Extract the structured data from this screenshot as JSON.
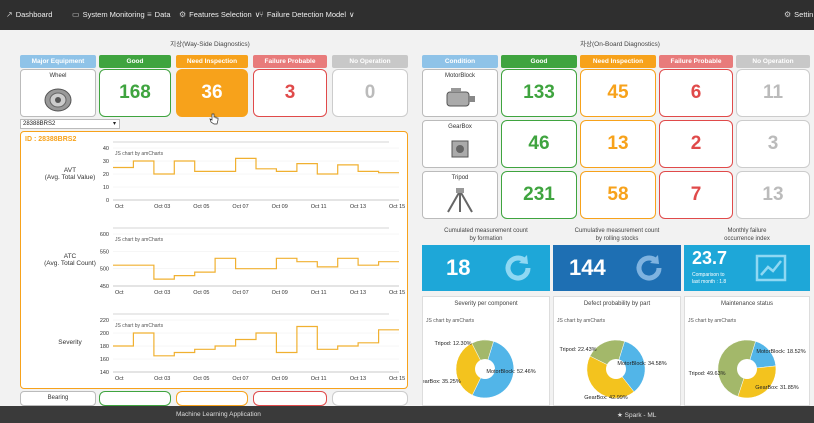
{
  "nav": {
    "items": [
      {
        "icon": "chart-line-icon",
        "glyph": "↗",
        "label": "Dashboard"
      },
      {
        "icon": "monitor-icon",
        "glyph": "▭",
        "label": "System Monitoring"
      },
      {
        "icon": "database-icon",
        "glyph": "≡",
        "label": "Data"
      },
      {
        "icon": "gear-icon",
        "glyph": "⚙",
        "label": "Features Selection"
      },
      {
        "icon": "sitemap-icon",
        "glyph": "⑂",
        "label": "Failure Detection Model"
      }
    ],
    "settings_label": "Settin",
    "settings_glyph": "⚙"
  },
  "wayside": {
    "title": "지상(Way-Side Diagnostics)",
    "headers": [
      "Major Equipment",
      "Good",
      "Need Inspection",
      "Failure Probable",
      "No Operation"
    ],
    "rows": [
      {
        "equipment": "Wheel",
        "good": "168",
        "need": "36",
        "fail": "3",
        "noop": "0"
      },
      {
        "equipment": "Bearing"
      }
    ],
    "select_value": "28388BRS2",
    "select_arrow": "▾",
    "id_label": "ID : 28388BRS2",
    "chart_rows": [
      {
        "label1": "AVT",
        "label2": "(Avg. Total Value)"
      },
      {
        "label1": "ATC",
        "label2": "(Avg. Total Count)"
      },
      {
        "label1": "Severity",
        "label2": ""
      }
    ],
    "credit": "JS chart by amCharts"
  },
  "onboard": {
    "title": "차상(On-Board Diagnostics)",
    "headers": [
      "Condition",
      "Good",
      "Need Inspection",
      "Failure Probable",
      "No Operation"
    ],
    "rows": [
      {
        "condition": "MotorBlock",
        "good": "133",
        "need": "45",
        "fail": "6",
        "noop": "11"
      },
      {
        "condition": "GearBox",
        "good": "46",
        "need": "13",
        "fail": "2",
        "noop": "3"
      },
      {
        "condition": "Tripod",
        "good": "231",
        "need": "58",
        "fail": "7",
        "noop": "13"
      }
    ],
    "kpis": [
      {
        "title1": "Cumulated measurement count",
        "title2": "by formation",
        "value": "18",
        "color": "#1ea7d8"
      },
      {
        "title1": "Cumulative measurement count",
        "title2": "by rolling stocks",
        "value": "144",
        "color": "#1e6fb3"
      },
      {
        "title1": "Monthly failure",
        "title2": "occurrence index",
        "value": "23.7",
        "sub1": "Comparison to",
        "sub2": "last month : 1.8",
        "color": "#1ea7d8"
      }
    ],
    "cards": [
      {
        "title": "Severity per component",
        "credit": "JS chart by amCharts"
      },
      {
        "title": "Defect probability by part",
        "credit": "JS chart by amCharts"
      },
      {
        "title": "Maintenance status",
        "credit": "JS chart by amCharts"
      }
    ]
  },
  "footer": {
    "left": "Machine Learning Application",
    "right": "Spark - ML",
    "right_glyph": "★"
  },
  "colors": {
    "good": "#3fa43f",
    "need": "#f7a21b",
    "fail": "#e04a4a",
    "noop": "#cccccc",
    "condition": "#8fc3e8",
    "line": "#f0b030"
  },
  "chart_data": [
    {
      "type": "line",
      "name": "AVT",
      "x": [
        "Oct",
        "Oct 03",
        "Oct 05",
        "Oct 07",
        "Oct 09",
        "Oct 11",
        "Oct 13",
        "Oct 15"
      ],
      "xticks": [
        "Oct",
        "Oct 03",
        "Oct 05",
        "Oct 07",
        "Oct 09",
        "Oct 11",
        "Oct 13",
        "Oct 15"
      ],
      "yticks": [
        "40",
        "30",
        "20",
        "10",
        "0"
      ],
      "ylim": [
        0,
        40
      ],
      "values": [
        25,
        30,
        20,
        30,
        22,
        22,
        32,
        24,
        22,
        28,
        20,
        27,
        22,
        21
      ],
      "series_color": "#f0b030"
    },
    {
      "type": "line",
      "name": "ATC",
      "xticks": [
        "Oct",
        "Oct 03",
        "Oct 05",
        "Oct 07",
        "Oct 09",
        "Oct 11",
        "Oct 13",
        "Oct 15"
      ],
      "yticks": [
        "600",
        "550",
        "500",
        "450"
      ],
      "ylim": [
        450,
        600
      ],
      "values": [
        510,
        510,
        470,
        480,
        490,
        530,
        500,
        500,
        530,
        520,
        505,
        530,
        510,
        520
      ],
      "series_color": "#f0b030"
    },
    {
      "type": "line",
      "name": "Severity",
      "xticks": [
        "Oct",
        "Oct 03",
        "Oct 05",
        "Oct 07",
        "Oct 09",
        "Oct 11",
        "Oct 13",
        "Oct 15"
      ],
      "yticks": [
        "220",
        "200",
        "180",
        "160",
        "140"
      ],
      "ylim": [
        140,
        220
      ],
      "values": [
        180,
        200,
        165,
        170,
        175,
        180,
        190,
        200,
        170,
        210,
        175,
        180,
        185,
        205
      ],
      "series_color": "#f0b030"
    },
    {
      "type": "pie",
      "title": "Severity per component",
      "slices": [
        {
          "label": "MotorBlock: 52.46%",
          "value": 52.46,
          "color": "#52b5e8"
        },
        {
          "label": "GearBox: 35.25%",
          "value": 35.25,
          "color": "#f3c31e"
        },
        {
          "label": "Tripod: 12.30%",
          "value": 12.3,
          "color": "#a3b86a"
        }
      ]
    },
    {
      "type": "pie",
      "title": "Defect probability by part",
      "slices": [
        {
          "label": "MotorBlock: 34.58%",
          "value": 34.58,
          "color": "#52b5e8"
        },
        {
          "label": "GearBox: 42.99%",
          "value": 42.99,
          "color": "#f3c31e"
        },
        {
          "label": "Tripod: 22.43%",
          "value": 22.43,
          "color": "#a3b86a"
        }
      ]
    },
    {
      "type": "pie",
      "title": "Maintenance status",
      "slices": [
        {
          "label": "MotorBlock: 18.52%",
          "value": 18.52,
          "color": "#52b5e8"
        },
        {
          "label": "GearBox: 31.85%",
          "value": 31.85,
          "color": "#f3c31e"
        },
        {
          "label": "Tripod: 49.63%",
          "value": 49.63,
          "color": "#a3b86a"
        }
      ]
    }
  ]
}
